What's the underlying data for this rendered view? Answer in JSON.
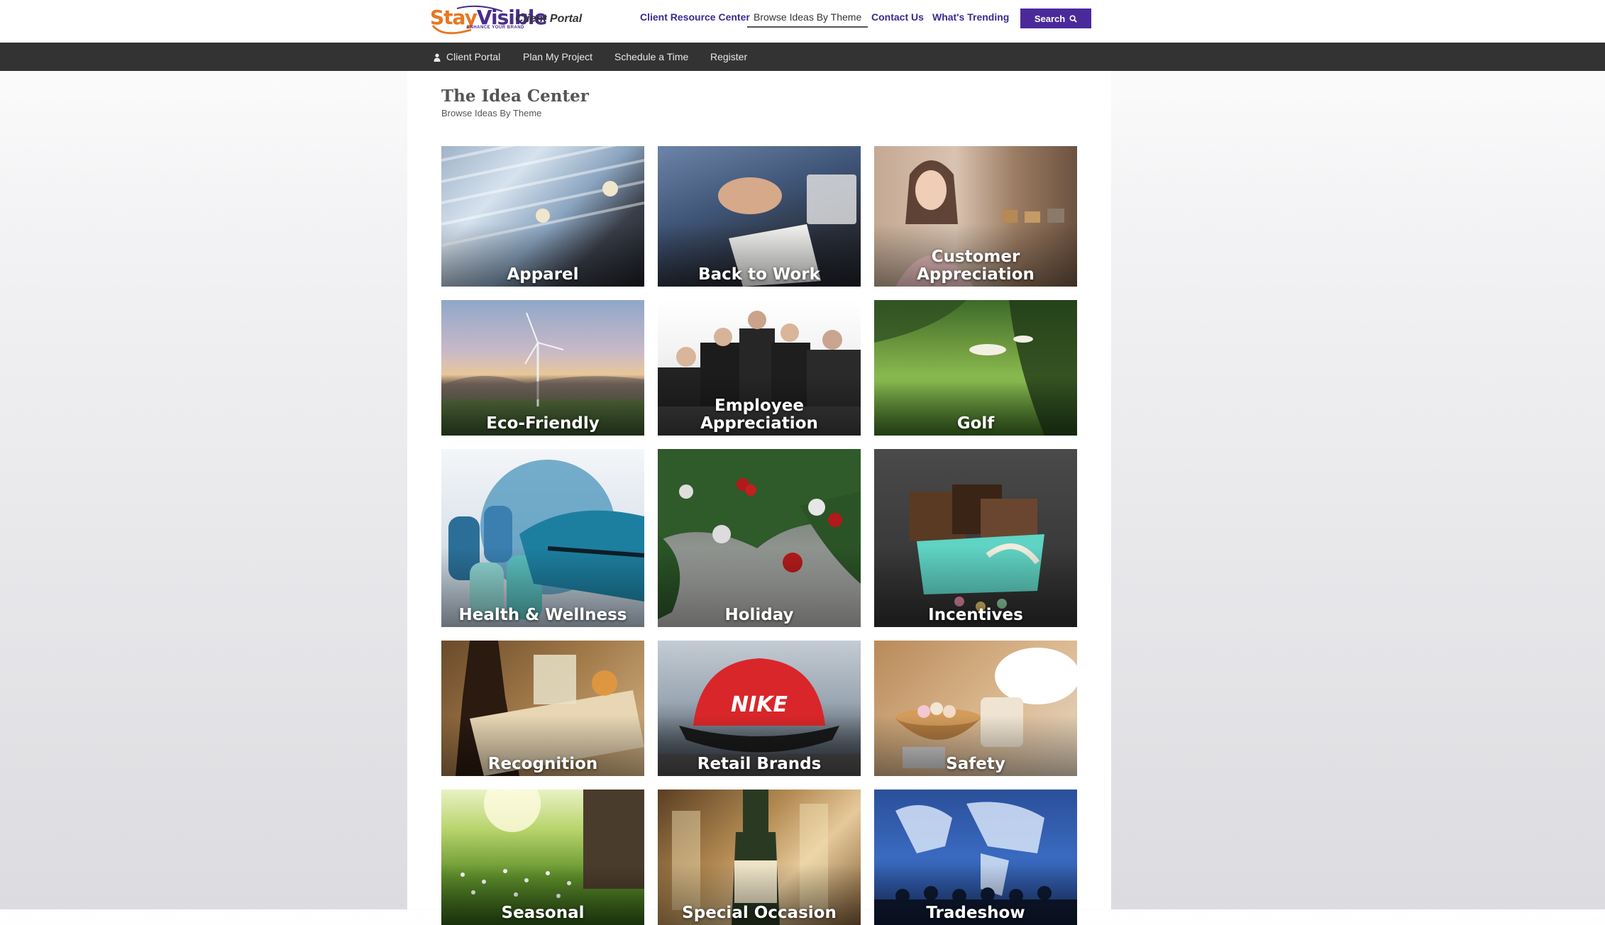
{
  "header": {
    "logo_part1": "Stay",
    "logo_part2": "Visible",
    "logo_tagline": "ENHANCE YOUR BRAND",
    "portal_label": "Client Portal",
    "nav": {
      "resource_center": "Client Resource Center",
      "browse_by_theme": "Browse Ideas By Theme",
      "contact_us": "Contact Us",
      "whats_trending": "What's Trending"
    },
    "search_label": "Search"
  },
  "subnav": {
    "client_portal": "Client Portal",
    "plan_project": "Plan My Project",
    "schedule": "Schedule a Time",
    "register": "Register"
  },
  "main": {
    "title": "The Idea Center",
    "subtitle": "Browse Ideas By Theme",
    "tiles": [
      {
        "line1": "Apparel",
        "line2": ""
      },
      {
        "line1": "Back to Work",
        "line2": ""
      },
      {
        "line1": "Customer",
        "line2": "Appreciation"
      },
      {
        "line1": "Eco-Friendly",
        "line2": ""
      },
      {
        "line1": "Employee",
        "line2": "Appreciation"
      },
      {
        "line1": "Golf",
        "line2": ""
      },
      {
        "line1": "Health & Wellness",
        "line2": ""
      },
      {
        "line1": "Holiday",
        "line2": ""
      },
      {
        "line1": "Incentives",
        "line2": ""
      },
      {
        "line1": "Recognition",
        "line2": ""
      },
      {
        "line1": "Retail Brands",
        "line2": ""
      },
      {
        "line1": "Safety",
        "line2": ""
      },
      {
        "line1": "Seasonal",
        "line2": ""
      },
      {
        "line1": "Special Occasion",
        "line2": ""
      },
      {
        "line1": "Tradeshow",
        "line2": ""
      }
    ]
  },
  "colors": {
    "brand_purple": "#4a2a9a",
    "brand_orange": "#e87722",
    "subnav_bg": "#333333"
  }
}
